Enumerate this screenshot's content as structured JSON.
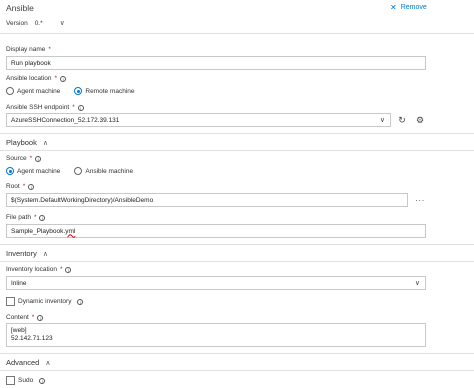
{
  "header": {
    "title": "Ansible",
    "remove_label": "Remove"
  },
  "version": {
    "label": "Version",
    "value": "0.*"
  },
  "display_name": {
    "label": "Display name",
    "value": "Run playbook"
  },
  "ansible_location": {
    "label": "Ansible location",
    "options": [
      "Agent machine",
      "Remote machine"
    ],
    "selected": "Remote machine"
  },
  "ssh_endpoint": {
    "label": "Ansible SSH endpoint",
    "value": "AzureSSHConnection_52.172.39.131"
  },
  "playbook_section": {
    "title": "Playbook"
  },
  "source": {
    "label": "Source",
    "options": [
      "Agent machine",
      "Ansible machine"
    ],
    "selected": "Agent machine"
  },
  "root": {
    "label": "Root",
    "value": "$(System.DefaultWorkingDirectory)/AnsibleDemo"
  },
  "file_path": {
    "label": "File path",
    "value_main": "Sample_Playbook.",
    "value_ext": "yml"
  },
  "inventory_section": {
    "title": "Inventory"
  },
  "inventory_location": {
    "label": "Inventory location",
    "value": "Inline"
  },
  "dynamic_inventory": {
    "label": "Dynamic inventory",
    "checked": false
  },
  "content": {
    "label": "Content",
    "value": "[web]\n52.142.71.123"
  },
  "advanced_section": {
    "title": "Advanced"
  },
  "sudo": {
    "label": "Sudo",
    "checked": false
  },
  "colors": {
    "accent": "#0078d4",
    "required": "#a4262c",
    "border": "#c8c8c8"
  }
}
